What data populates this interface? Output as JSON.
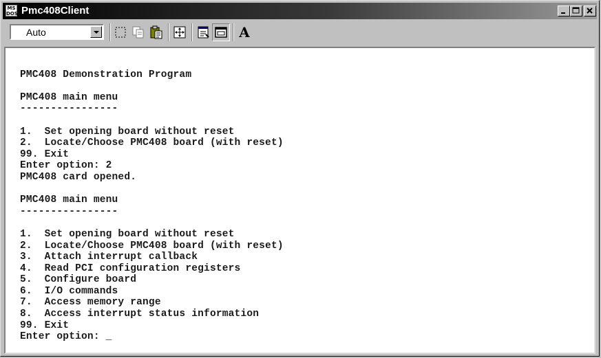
{
  "window": {
    "title": "Pmc408Client",
    "icon_text": "MS\nDOS",
    "controls": [
      "minimize-icon",
      "maximize-icon",
      "close-icon"
    ]
  },
  "toolbar": {
    "font_size_value": "Auto",
    "tools": [
      "mark-icon",
      "copy-icon",
      "paste-icon",
      "fullscreen-icon",
      "properties-icon",
      "background-icon",
      "font-icon"
    ],
    "font_label": "A"
  },
  "console": {
    "lines": [
      "",
      "PMC408 Demonstration Program",
      "",
      "PMC408 main menu",
      "----------------",
      "",
      "1.  Set opening board without reset",
      "2.  Locate/Choose PMC408 board (with reset)",
      "99. Exit",
      "Enter option: 2",
      "PMC408 card opened.",
      "",
      "PMC408 main menu",
      "----------------",
      "",
      "1.  Set opening board without reset",
      "2.  Locate/Choose PMC408 board (with reset)",
      "3.  Attach interrupt callback",
      "4.  Read PCI configuration registers",
      "5.  Configure board",
      "6.  I/O commands",
      "7.  Access memory range",
      "8.  Access interrupt status information",
      "99. Exit",
      "Enter option: _"
    ]
  }
}
